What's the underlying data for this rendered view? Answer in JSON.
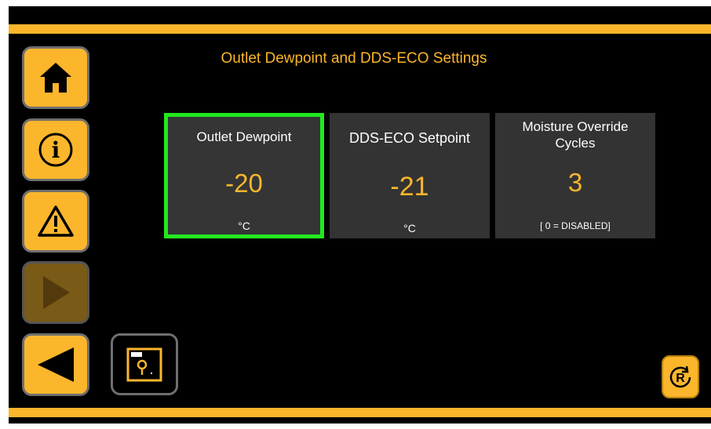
{
  "title": "Outlet Dewpoint and DDS-ECO Settings",
  "nav": [
    {
      "name": "home",
      "icon": "home-icon"
    },
    {
      "name": "info",
      "icon": "info-icon"
    },
    {
      "name": "alarm",
      "icon": "warning-icon"
    },
    {
      "name": "play",
      "icon": "play-icon",
      "state": "disabled"
    },
    {
      "name": "back",
      "icon": "back-arrow-icon"
    }
  ],
  "cards": [
    {
      "label": "Outlet Dewpoint",
      "value": "-20",
      "unit": "°C",
      "selected": true
    },
    {
      "label": "DDS-ECO Setpoint",
      "value": "-21",
      "unit": "°C",
      "selected": false
    },
    {
      "label": "Moisture Override Cycles",
      "value": "3",
      "unit": "[ 0 = DISABLED]",
      "selected": false
    }
  ],
  "colors": {
    "accent": "#fbb62c",
    "selected_border": "#22e81f",
    "card_bg": "#333333",
    "background": "#000000"
  },
  "save_icon": "save-settings-icon",
  "reset_icon": "reset-r-icon"
}
